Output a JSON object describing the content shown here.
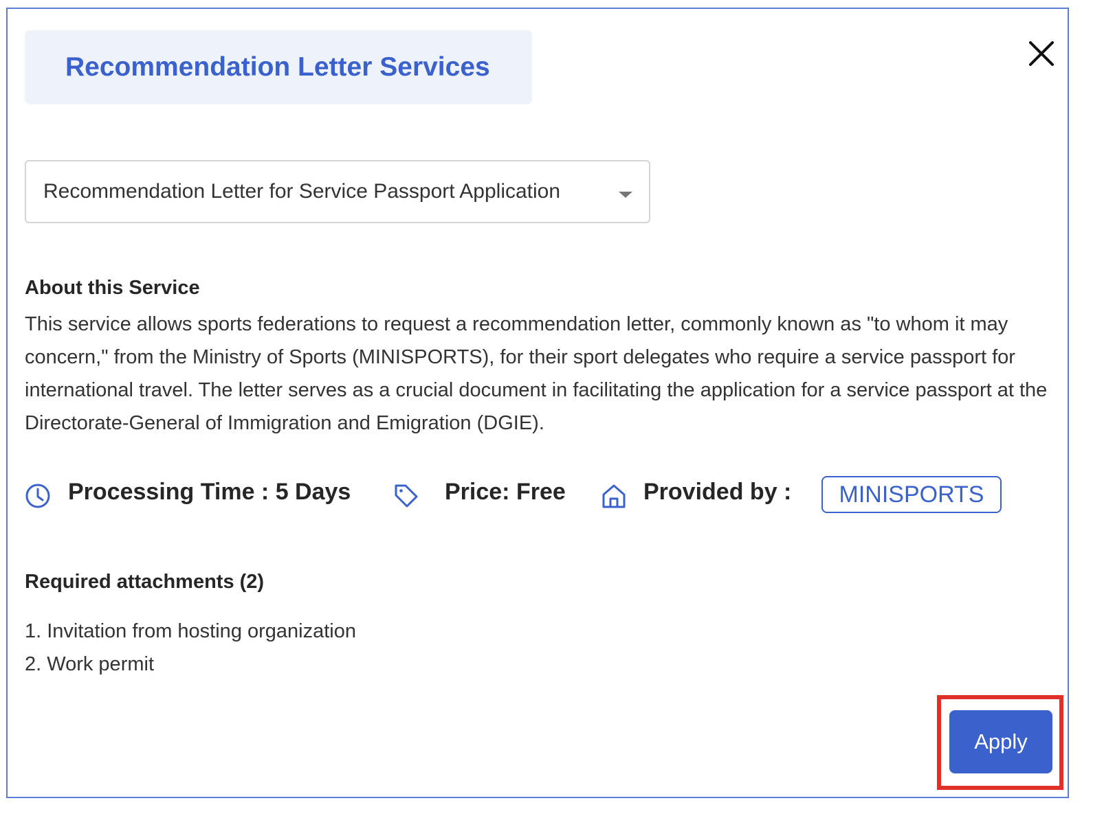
{
  "modal": {
    "title": "Recommendation Letter Services",
    "close_icon": "close-icon"
  },
  "service_select": {
    "selected": "Recommendation Letter for Service Passport Application",
    "caret_icon": "caret-down-icon"
  },
  "about": {
    "heading": "About this Service",
    "description": "This service allows sports federations to request a recommendation letter, commonly known as \"to whom it may concern,\" from the Ministry of Sports (MINISPORTS), for their sport delegates who require a service passport for international travel. The letter serves as a crucial document in facilitating the application for a service passport at the Directorate-General of Immigration and Emigration (DGIE)."
  },
  "info": {
    "processing_time": "Processing Time : 5 Days",
    "processing_icon": "clock-icon",
    "price": "Price: Free",
    "price_icon": "tag-icon",
    "provided_by_label": "Provided by :",
    "provider_icon": "home-icon",
    "provider": "MINISPORTS"
  },
  "attachments": {
    "heading": "Required attachments (2)",
    "items": [
      "1. Invitation from hosting organization",
      "2. Work permit"
    ]
  },
  "actions": {
    "apply_label": "Apply"
  },
  "colors": {
    "accent": "#3a61cc",
    "title_bg": "#edf2fb",
    "modal_border": "#5b7fd6",
    "highlight": "#e0302a"
  }
}
